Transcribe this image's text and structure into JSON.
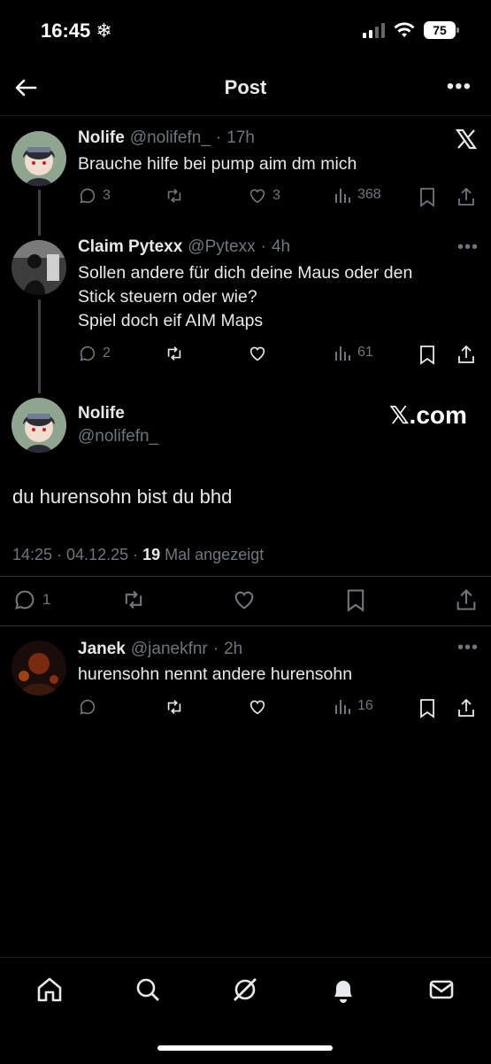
{
  "status_bar": {
    "time": "16:45",
    "battery": "75"
  },
  "header": {
    "title": "Post"
  },
  "posts": [
    {
      "name": "Nolife",
      "handle": "@nolifefn_",
      "time": "17h",
      "text": "Brauche hilfe bei pump aim dm mich",
      "replies": "3",
      "reposts": "",
      "likes": "3",
      "views": "368"
    },
    {
      "name": "Claim Pytexx",
      "handle": "@Pytexx",
      "time": "4h",
      "text_lines": [
        "Sollen andere für dich deine Maus oder den",
        "Stick steuern oder wie?",
        "Spiel doch eif AIM Maps"
      ],
      "replies": "2",
      "reposts": "",
      "likes": "",
      "views": "61"
    }
  ],
  "main_post": {
    "name": "Nolife",
    "handle": "@nolifefn_",
    "watermark": "𝕏.com",
    "text": "du hurensohn bist du bhd",
    "timestamp": "14:25 · 04.12.25 · ",
    "view_count": "19",
    "view_label": " Mal angezeigt",
    "replies": "1"
  },
  "reply": {
    "name": "Janek",
    "handle": "@janekfnr",
    "time": "2h",
    "text": "hurensohn nennt andere hurensohn",
    "views": "16"
  },
  "separator": "·",
  "icons": [
    "back-arrow-icon",
    "more-icon",
    "x-logo-icon",
    "reply-icon",
    "repost-icon",
    "like-icon",
    "views-icon",
    "bookmark-icon",
    "share-icon",
    "home-icon",
    "search-icon",
    "grok-icon",
    "notifications-icon",
    "messages-icon"
  ],
  "colors": {
    "background": "#000000",
    "text": "#e7e9ea",
    "muted": "#71767b"
  }
}
